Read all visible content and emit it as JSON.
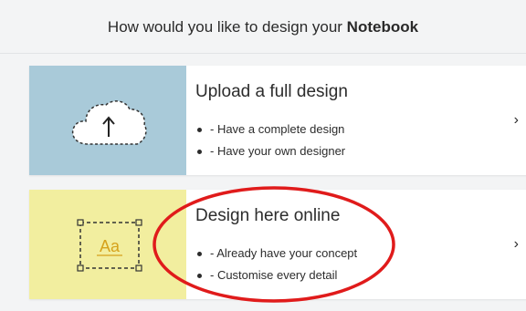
{
  "header": {
    "prefix": "How would you like to design your ",
    "product": "Notebook"
  },
  "options": [
    {
      "title": "Upload a full design",
      "bullets": [
        "- Have a complete design",
        "- Have your own designer"
      ],
      "icon": "cloud-upload-icon",
      "panel_color": "#a9cad9"
    },
    {
      "title": "Design here online",
      "bullets": [
        "- Already have your concept",
        "- Customise every detail"
      ],
      "icon": "text-edit-icon",
      "icon_text": "Aa",
      "panel_color": "#f2ee9f"
    }
  ],
  "annotation": {
    "color": "#e01b1b"
  },
  "colors": {
    "background": "#f3f4f5",
    "text": "#2c2c2c"
  }
}
